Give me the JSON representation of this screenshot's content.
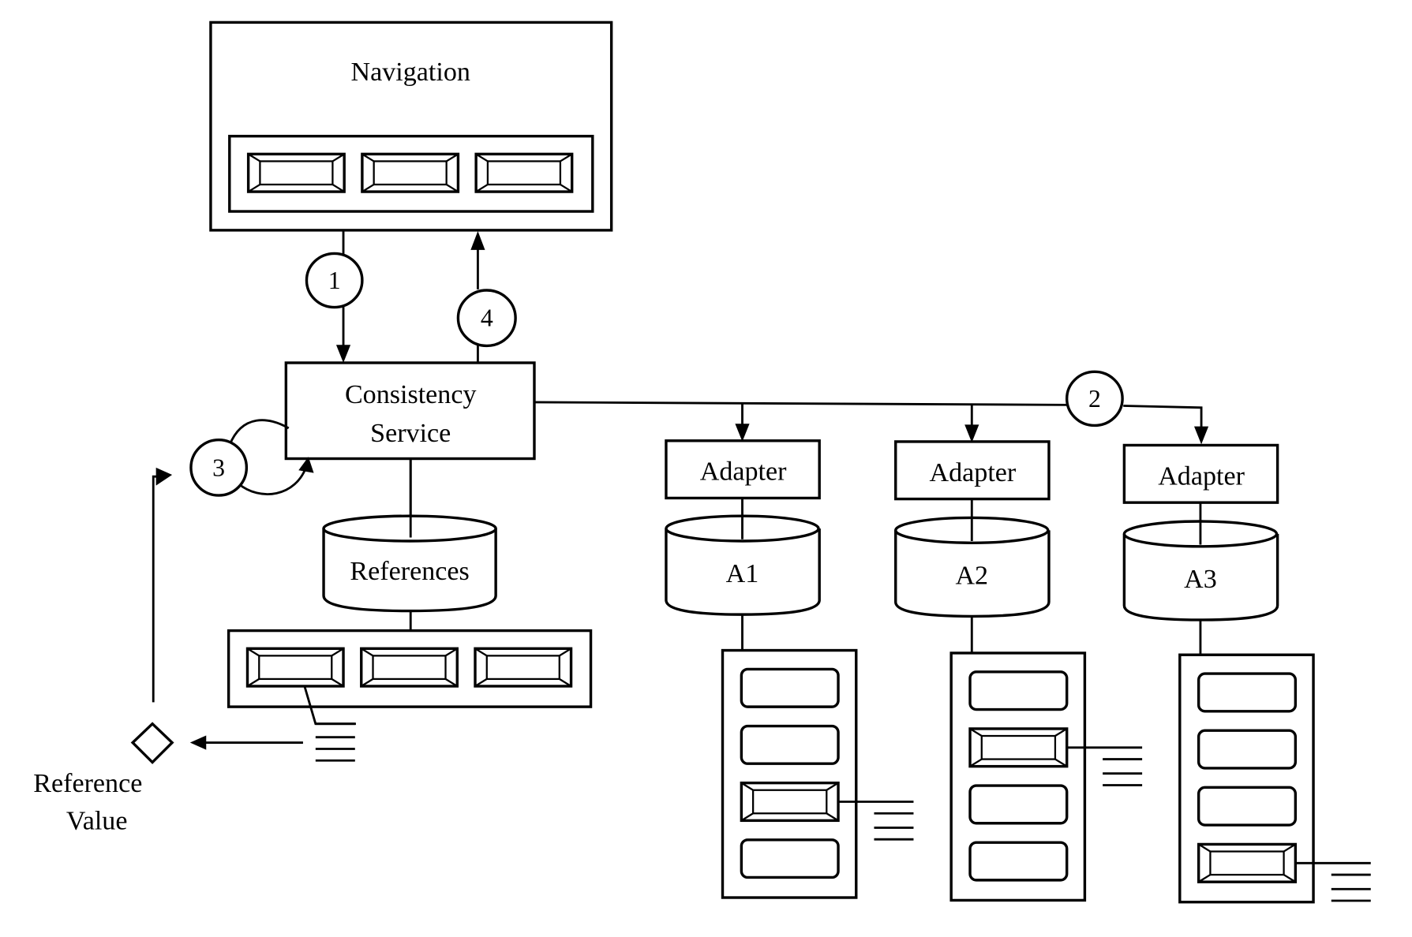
{
  "diagram": {
    "navigation": {
      "title": "Navigation",
      "widget_count": 3
    },
    "consistency_service": {
      "line1": "Consistency",
      "line2": "Service"
    },
    "references_store": {
      "label": "References",
      "widget_count": 3
    },
    "reference_value": {
      "line1": "Reference",
      "line2": "Value"
    },
    "steps": [
      {
        "id": "1",
        "label": "1",
        "from": "Navigation",
        "to": "Consistency Service"
      },
      {
        "id": "2",
        "label": "2",
        "from": "Consistency Service",
        "to": "Adapters"
      },
      {
        "id": "3",
        "label": "3",
        "from": "Consistency Service",
        "to": "Consistency Service"
      },
      {
        "id": "4",
        "label": "4",
        "from": "Consistency Service",
        "to": "Navigation"
      }
    ],
    "adapters": [
      {
        "adapter_label": "Adapter",
        "store_label": "A1",
        "list_items": 4,
        "selected_index": 2
      },
      {
        "adapter_label": "Adapter",
        "store_label": "A2",
        "list_items": 4,
        "selected_index": 1
      },
      {
        "adapter_label": "Adapter",
        "store_label": "A3",
        "list_items": 4,
        "selected_index": 3
      }
    ]
  }
}
